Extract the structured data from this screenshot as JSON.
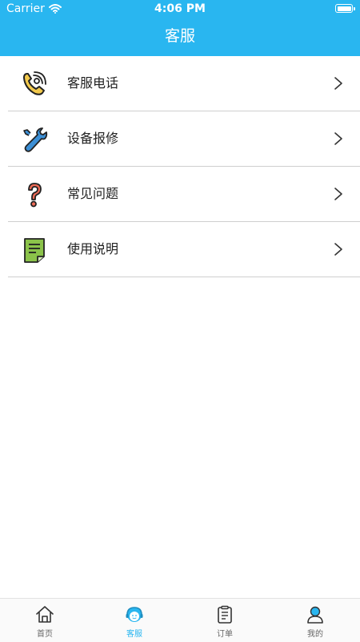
{
  "status_bar": {
    "carrier": "Carrier",
    "time": "4:06 PM"
  },
  "header": {
    "title": "客服"
  },
  "menu": {
    "items": [
      {
        "label": "客服电话",
        "icon": "phone-icon"
      },
      {
        "label": "设备报修",
        "icon": "wrench-icon"
      },
      {
        "label": "常见问题",
        "icon": "question-icon"
      },
      {
        "label": "使用说明",
        "icon": "document-icon"
      }
    ]
  },
  "tabbar": {
    "active_color": "#29b6f0",
    "items": [
      {
        "label": "首页",
        "icon": "home-icon",
        "active": false
      },
      {
        "label": "客服",
        "icon": "customer-service-icon",
        "active": true
      },
      {
        "label": "订单",
        "icon": "order-icon",
        "active": false
      },
      {
        "label": "我的",
        "icon": "profile-icon",
        "active": false
      }
    ]
  },
  "colors": {
    "header": "#29b6f0",
    "divider": "#cfcfcf"
  }
}
